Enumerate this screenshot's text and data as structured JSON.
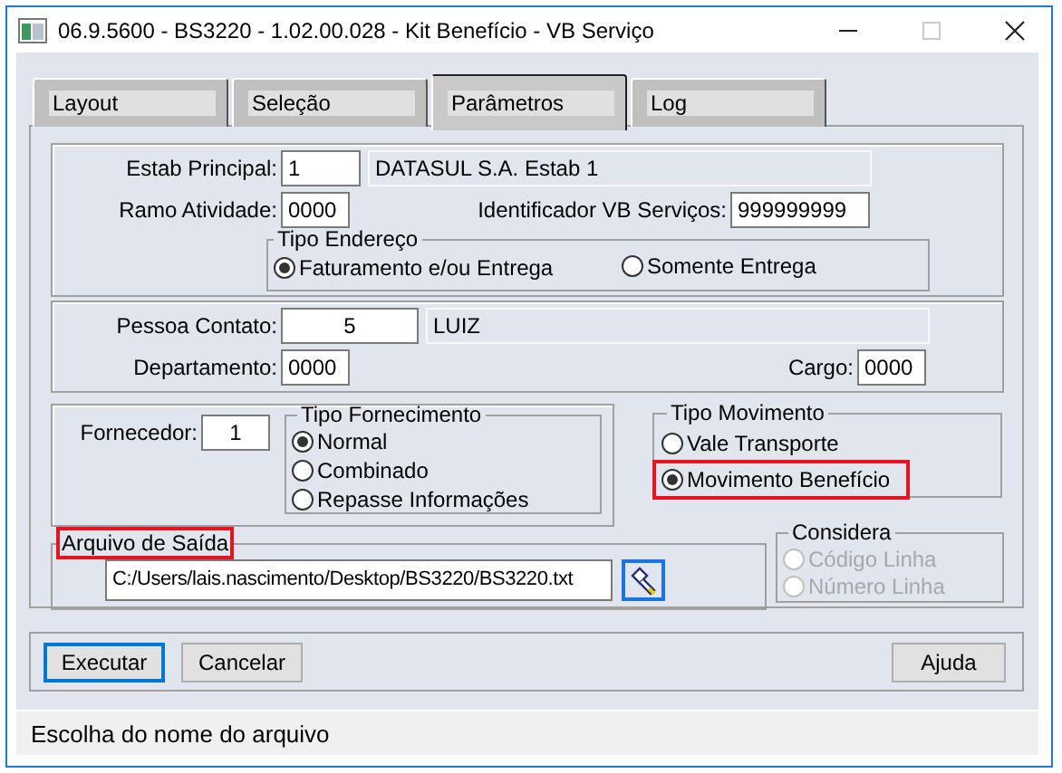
{
  "window": {
    "title": "06.9.5600 - BS3220 - 1.02.00.028 - Kit Benefício - VB Serviço"
  },
  "tabs": [
    {
      "label": "Layout",
      "selected": false
    },
    {
      "label": "Seleção",
      "selected": false
    },
    {
      "label": "Parâmetros",
      "selected": true
    },
    {
      "label": "Log",
      "selected": false
    }
  ],
  "estab_principal": {
    "label": "Estab Principal:",
    "value": "1",
    "description": "DATASUL S.A. Estab 1"
  },
  "ramo_atividade": {
    "label": "Ramo Atividade:",
    "value": "0000"
  },
  "identificador": {
    "label": "Identificador VB Serviços:",
    "value": "999999999"
  },
  "tipo_endereco": {
    "legend": "Tipo Endereço",
    "options": [
      {
        "label": "Faturamento e/ou Entrega",
        "selected": true
      },
      {
        "label": "Somente Entrega",
        "selected": false
      }
    ]
  },
  "pessoa_contato": {
    "label": "Pessoa Contato:",
    "value": "5",
    "description": "LUIZ"
  },
  "departamento": {
    "label": "Departamento:",
    "value": "0000"
  },
  "cargo": {
    "label": "Cargo:",
    "value": "0000"
  },
  "fornecedor": {
    "label": "Fornecedor:",
    "value": "1"
  },
  "tipo_fornecimento": {
    "legend": "Tipo Fornecimento",
    "options": [
      {
        "label": "Normal",
        "selected": true
      },
      {
        "label": "Combinado",
        "selected": false
      },
      {
        "label": "Repasse Informações",
        "selected": false
      }
    ]
  },
  "tipo_movimento": {
    "legend": "Tipo Movimento",
    "options": [
      {
        "label": "Vale Transporte",
        "selected": false,
        "highlighted": false
      },
      {
        "label": "Movimento Benefício",
        "selected": true,
        "highlighted": true
      }
    ]
  },
  "arquivo_saida": {
    "legend": "Arquivo de Saída",
    "highlighted": true,
    "value": "C:/Users/lais.nascimento/Desktop/BS3220/BS3220.txt"
  },
  "considera": {
    "legend": "Considera",
    "disabled": true,
    "options": [
      {
        "label": "Código Linha",
        "selected": false
      },
      {
        "label": "Número Linha",
        "selected": false
      }
    ]
  },
  "buttons": [
    {
      "label": "Executar",
      "focused": true
    },
    {
      "label": "Cancelar",
      "focused": false
    }
  ],
  "help_button": {
    "label": "Ajuda",
    "focused": false
  },
  "status_bar": {
    "text": "Escolha do nome do arquivo"
  }
}
